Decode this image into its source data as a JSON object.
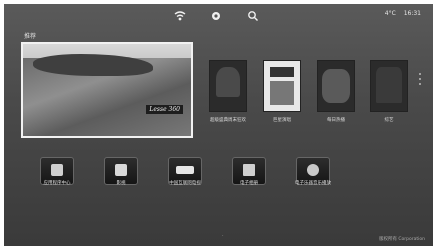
{
  "topbar": {
    "icons": [
      "wifi-icon",
      "settings-icon",
      "search-icon"
    ],
    "status_text": "4°C",
    "time_text": "16:31"
  },
  "section": {
    "title": "推荐"
  },
  "featured": {
    "tag": "Lesse 360"
  },
  "posters": [
    {
      "caption": "超级盛典周末狂欢"
    },
    {
      "caption": "巨星演唱"
    },
    {
      "caption": "每日热播"
    },
    {
      "caption": "综艺"
    }
  ],
  "apps": [
    {
      "icon": "app-store-icon",
      "label": "应用程序中心"
    },
    {
      "icon": "video-icon",
      "label": "影视"
    },
    {
      "icon": "tv-station-icon",
      "label": "中国互联网电视"
    },
    {
      "icon": "camera-icon",
      "label": "电子相册"
    },
    {
      "icon": "music-icon",
      "label": "电子乐器音乐播放"
    }
  ],
  "footer": {
    "dot": "·",
    "right_text": "版权所有 Corporation"
  }
}
